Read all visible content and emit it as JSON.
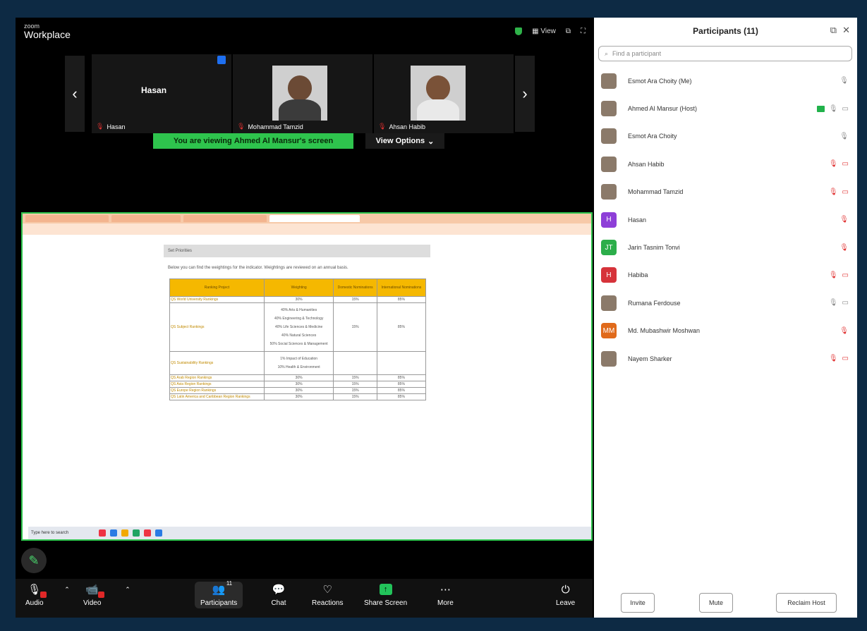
{
  "app": {
    "logo_small": "zoom",
    "logo_large": "Workplace",
    "view_label": "View"
  },
  "gallery": [
    {
      "name": "Hasan",
      "display": "Hasan",
      "type": "text"
    },
    {
      "name": "Mohammad Tamzid",
      "type": "photo"
    },
    {
      "name": "Ahsan Habib",
      "type": "photo"
    }
  ],
  "share": {
    "banner_prefix": "You are viewing ",
    "banner_name": "Ahmed Al Mansur's screen",
    "view_options": "View Options"
  },
  "doc": {
    "section": "Set Priorities",
    "intro": "Below you can find the weightings for the indicator. Weightings are reviewed on an annual basis.",
    "headers": [
      "Ranking Project",
      "Weighting",
      "Domestic Nominations",
      "International Nominations"
    ],
    "rows": [
      {
        "project": "QS World University Rankings",
        "weights": [
          "30%"
        ],
        "dom": "15%",
        "intl": "85%"
      },
      {
        "project": "QS Subject Rankings",
        "weights": [
          "40% Arts & Humanities",
          "40% Engineering & Technology",
          "40% Life Sciences & Medicine",
          "40% Natural Sciences",
          "50% Social Sciences & Management"
        ],
        "dom": "15%",
        "intl": "85%"
      },
      {
        "project": "QS Sustainability Rankings",
        "weights": [
          "1% Impact of Education",
          "10% Health & Environment"
        ],
        "dom": "",
        "intl": ""
      },
      {
        "project": "QS Arab Region Rankings",
        "weights": [
          "30%"
        ],
        "dom": "15%",
        "intl": "85%"
      },
      {
        "project": "QS Asia Region Rankings",
        "weights": [
          "30%"
        ],
        "dom": "15%",
        "intl": "85%"
      },
      {
        "project": "QS Europe Region Rankings",
        "weights": [
          "30%"
        ],
        "dom": "15%",
        "intl": "85%"
      },
      {
        "project": "QS Latin America and Caribbean Region Rankings",
        "weights": [
          "30%"
        ],
        "dom": "15%",
        "intl": "85%"
      }
    ],
    "taskbar_search": "Type here to search"
  },
  "toolbar": {
    "audio": "Audio",
    "video": "Video",
    "participants": "Participants",
    "participants_count": "11",
    "chat": "Chat",
    "reactions": "Reactions",
    "share_screen": "Share Screen",
    "more": "More",
    "leave": "Leave"
  },
  "panel": {
    "title": "Participants (11)",
    "search_placeholder": "Find a participant",
    "participants": [
      {
        "name": "Esmot Ara Choity (Me)",
        "avatar": "photo",
        "initials": "",
        "color": "",
        "mic": "on",
        "cam": ""
      },
      {
        "name": "Ahmed Al Mansur (Host)",
        "avatar": "photo",
        "initials": "",
        "color": "",
        "mic": "on",
        "cam": "on",
        "share": true
      },
      {
        "name": "Esmot Ara Choity",
        "avatar": "photo",
        "initials": "",
        "color": "",
        "mic": "on",
        "cam": ""
      },
      {
        "name": "Ahsan Habib",
        "avatar": "photo",
        "initials": "",
        "color": "",
        "mic": "off",
        "cam": "off"
      },
      {
        "name": "Mohammad Tamzid",
        "avatar": "photo",
        "initials": "",
        "color": "",
        "mic": "off",
        "cam": "off"
      },
      {
        "name": "Hasan",
        "avatar": "initials",
        "initials": "H",
        "color": "#8e3fd8",
        "mic": "off",
        "cam": ""
      },
      {
        "name": "Jarin Tasnim Tonvi",
        "avatar": "initials",
        "initials": "JT",
        "color": "#2cae4a",
        "mic": "off",
        "cam": ""
      },
      {
        "name": "Habiba",
        "avatar": "initials",
        "initials": "H",
        "color": "#d6333a",
        "mic": "off",
        "cam": "off"
      },
      {
        "name": "Rumana Ferdouse",
        "avatar": "photo",
        "initials": "",
        "color": "",
        "mic": "on",
        "cam": "on"
      },
      {
        "name": "Md. Mubashwir Moshwan",
        "avatar": "initials",
        "initials": "MM",
        "color": "#e06a1b",
        "mic": "off",
        "cam": ""
      },
      {
        "name": "Nayem Sharker",
        "avatar": "photo",
        "initials": "",
        "color": "",
        "mic": "off",
        "cam": "off"
      }
    ],
    "invite": "Invite",
    "mute": "Mute",
    "reclaim": "Reclaim Host"
  }
}
